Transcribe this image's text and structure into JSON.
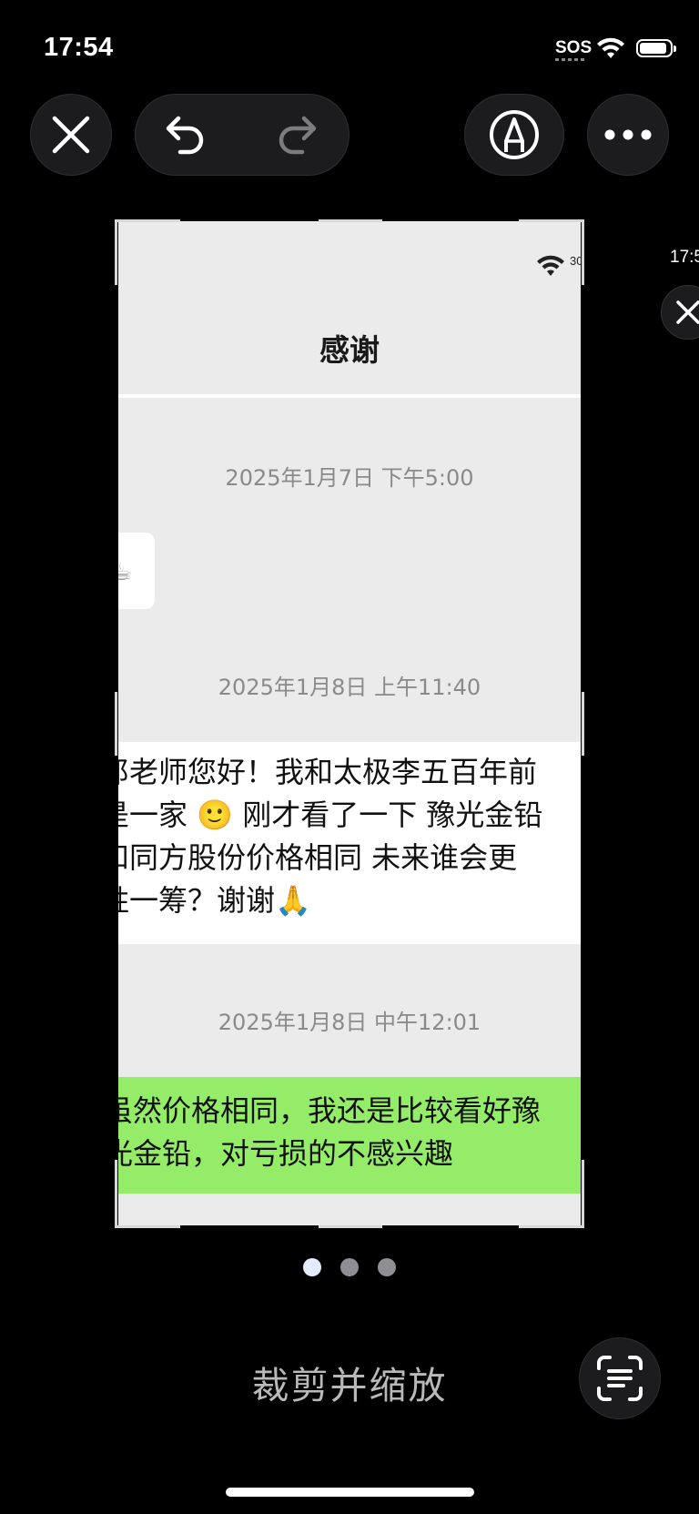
{
  "status_bar": {
    "time": "17:54",
    "sos": "SOS"
  },
  "toolbar": {
    "close_icon": "close-icon",
    "undo_icon": "undo-icon",
    "redo_icon": "redo-icon",
    "markup_icon": "markup-pen-icon",
    "more_icon": "more-icon"
  },
  "preview": {
    "status_signal_label": "30",
    "chat_title": "感谢",
    "timestamps": [
      "2025年1月7日 下午5:00",
      "2025年1月8日 上午11:40",
      "2025年1月8日 中午12:01"
    ],
    "message_1": "郎老师您好！我和太极李五百年前\n是一家 🙂 刚才看了一下 豫光金铅\n和同方股份价格相同 未来谁会更\n胜一筹？谢谢🙏",
    "message_2": "虽然价格相同，我还是比较看好豫\n光金铅，对亏损的不感兴趣"
  },
  "next_preview": {
    "time": "17:5"
  },
  "pagination": {
    "count": 3,
    "active_index": 0
  },
  "bottom": {
    "crop_label": "裁剪并缩放",
    "scan_icon": "text-scan-icon"
  },
  "colors": {
    "background": "#000000",
    "outgoing_bubble": "#95ec69",
    "incoming_bubble": "#ffffff",
    "chat_background": "#ebebeb"
  }
}
